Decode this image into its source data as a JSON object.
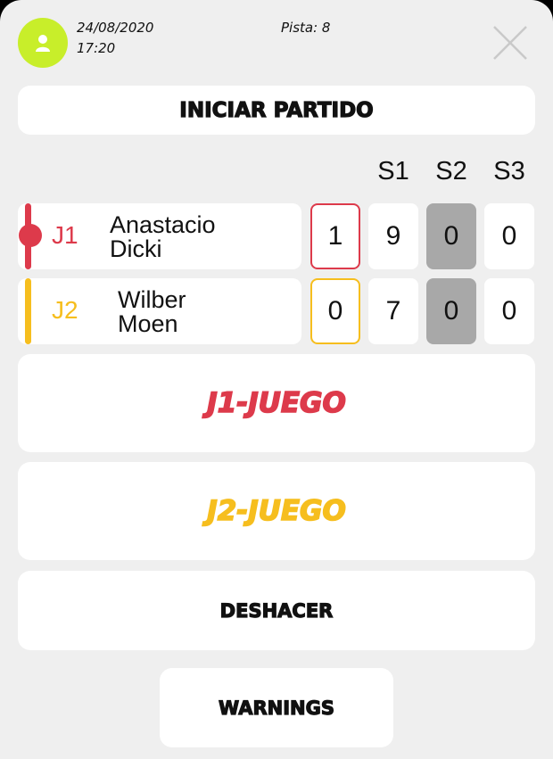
{
  "header": {
    "date": "24/08/2020",
    "time": "17:20",
    "court": "Pista: 8",
    "avatar_icon": "user-icon",
    "close_icon": "close-icon"
  },
  "start_button": "INICIAR PARTIDO",
  "sets_header": [
    "S1",
    "S2",
    "S3"
  ],
  "players": [
    {
      "tag": "J1",
      "name_line1": "Anastacio",
      "name_line2": "Dicki",
      "game": "1",
      "sets": [
        "9",
        "0",
        "0"
      ],
      "color": "#dd3a4b",
      "serving": true
    },
    {
      "tag": "J2",
      "name_line1": "Wilber",
      "name_line2": "Moen",
      "game": "0",
      "sets": [
        "7",
        "0",
        "0"
      ],
      "color": "#f6be1e",
      "serving": false
    }
  ],
  "actions": {
    "j1_game": "J1-JUEGO",
    "j2_game": "J2-JUEGO",
    "undo": "DESHACER",
    "warnings": "WARNINGS"
  },
  "colors": {
    "accent_green": "#c8ee2a",
    "player1": "#dd3a4b",
    "player2": "#f6be1e",
    "current_set_bg": "#a8a8a8"
  }
}
